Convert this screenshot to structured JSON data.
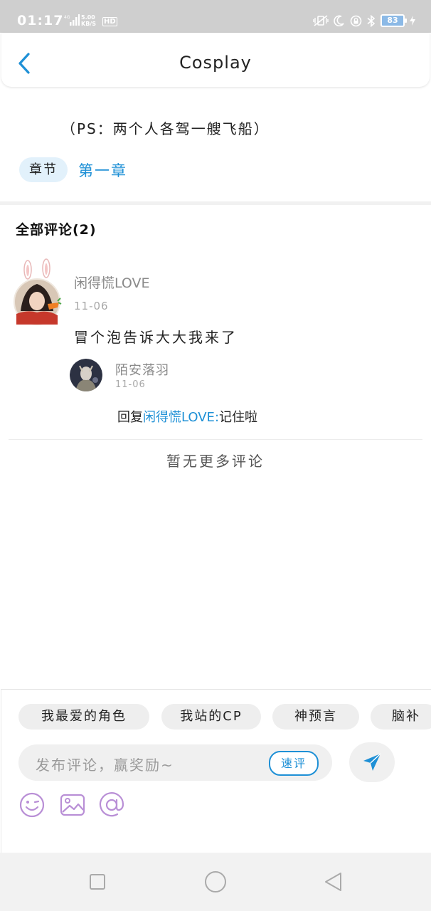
{
  "status_bar": {
    "time": "01:17",
    "network": "4G",
    "speed_value": "5.00",
    "speed_unit": "KB/S",
    "hd": "HD",
    "battery": "83"
  },
  "header": {
    "title": "Cosplay"
  },
  "chapter": {
    "ps_text": "（PS：两个人各驾一艘飞船）",
    "badge": "章节",
    "name": "第一章"
  },
  "comments": {
    "heading": "全部评论(2)",
    "items": [
      {
        "user": "闲得慌LOVE",
        "date": "11-06",
        "text": "冒个泡告诉大大我来了",
        "replies": [
          {
            "user": "陌安落羽",
            "date": "11-06",
            "prefix": "回复",
            "target": "闲得慌LOVE",
            "colon": ":",
            "text": "记住啦"
          }
        ]
      }
    ],
    "no_more": "暂无更多评论"
  },
  "composer": {
    "chips": [
      "我最爱的角色",
      "我站的CP",
      "神预言",
      "脑补"
    ],
    "placeholder": "发布评论，赢奖励~",
    "quick_review": "速评",
    "accent": "#1e90d6",
    "tool_icon_color": "#b98fd6"
  }
}
